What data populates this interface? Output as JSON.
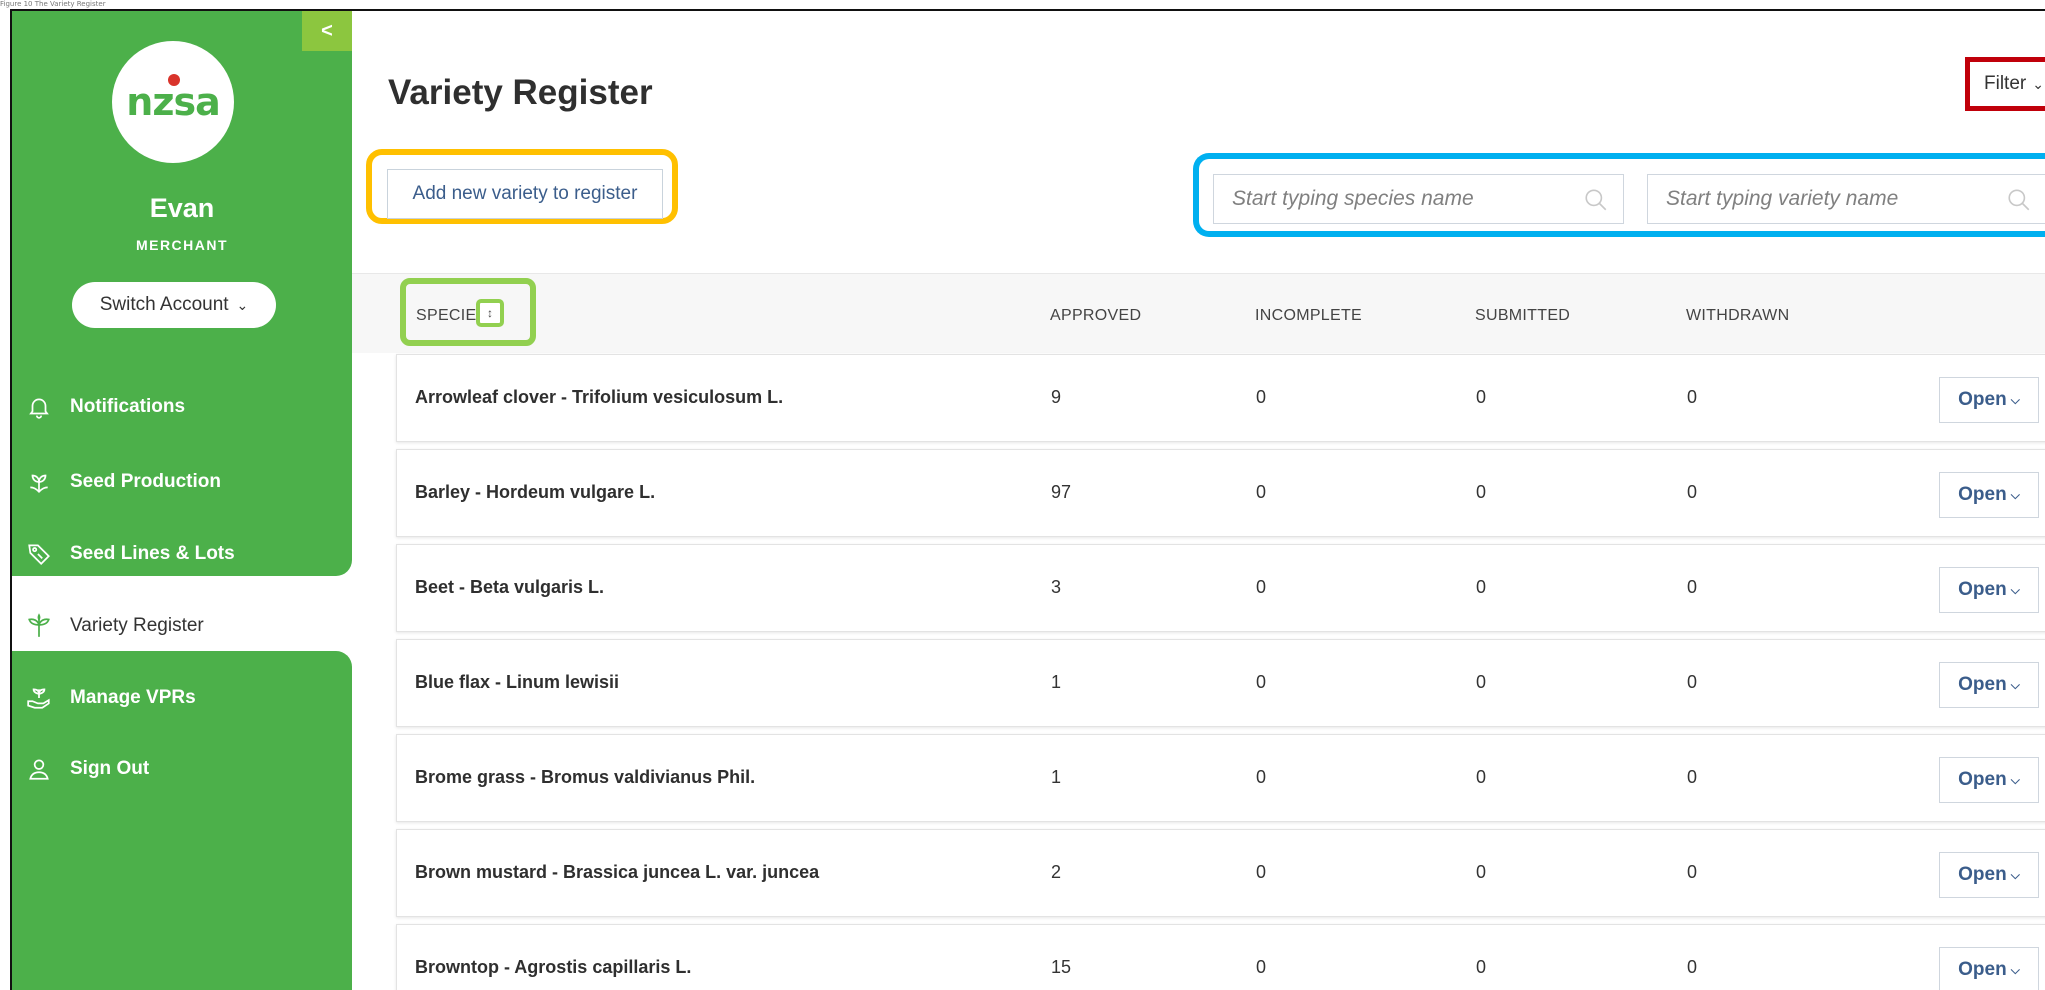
{
  "caption": "Figure 10 The Variety Register",
  "sidebar": {
    "collapse_label": "<",
    "logo_text": "nzsa",
    "user_name": "Evan",
    "user_role": "MERCHANT",
    "switch_account_label": "Switch Account",
    "nav": [
      {
        "label": "Notifications",
        "icon": "bell-icon"
      },
      {
        "label": "Seed Production",
        "icon": "plant-icon"
      },
      {
        "label": "Seed Lines & Lots",
        "icon": "tag-icon"
      },
      {
        "label": "Variety Register",
        "icon": "sprout-icon",
        "active": true
      },
      {
        "label": "Manage VPRs",
        "icon": "hand-plant-icon"
      },
      {
        "label": "Sign Out",
        "icon": "user-icon"
      }
    ],
    "colors": {
      "green": "#4cb04a",
      "light_green": "#8cc63f"
    }
  },
  "main": {
    "title": "Variety Register",
    "filter_label": "Filter",
    "add_button_label": "Add new variety to register",
    "species_search_placeholder": "Start typing species name",
    "variety_search_placeholder": "Start typing variety name",
    "columns": [
      "SPECIES",
      "APPROVED",
      "INCOMPLETE",
      "SUBMITTED",
      "WITHDRAWN"
    ],
    "open_label": "Open",
    "rows": [
      {
        "species": "Arrowleaf clover - Trifolium vesiculosum L.",
        "approved": "9",
        "incomplete": "0",
        "submitted": "0",
        "withdrawn": "0"
      },
      {
        "species": "Barley - Hordeum vulgare L.",
        "approved": "97",
        "incomplete": "0",
        "submitted": "0",
        "withdrawn": "0"
      },
      {
        "species": "Beet - Beta vulgaris L.",
        "approved": "3",
        "incomplete": "0",
        "submitted": "0",
        "withdrawn": "0"
      },
      {
        "species": "Blue flax - Linum lewisii",
        "approved": "1",
        "incomplete": "0",
        "submitted": "0",
        "withdrawn": "0"
      },
      {
        "species": "Brome grass - Bromus valdivianus Phil.",
        "approved": "1",
        "incomplete": "0",
        "submitted": "0",
        "withdrawn": "0"
      },
      {
        "species": "Brown mustard - Brassica juncea L. var. juncea",
        "approved": "2",
        "incomplete": "0",
        "submitted": "0",
        "withdrawn": "0"
      },
      {
        "species": "Browntop - Agrostis capillaris L.",
        "approved": "15",
        "incomplete": "0",
        "submitted": "0",
        "withdrawn": "0"
      }
    ],
    "highlight_colors": {
      "filter": "#c0000a",
      "add": "#ffc000",
      "search": "#00b0f0",
      "sort": "#92d050"
    }
  }
}
